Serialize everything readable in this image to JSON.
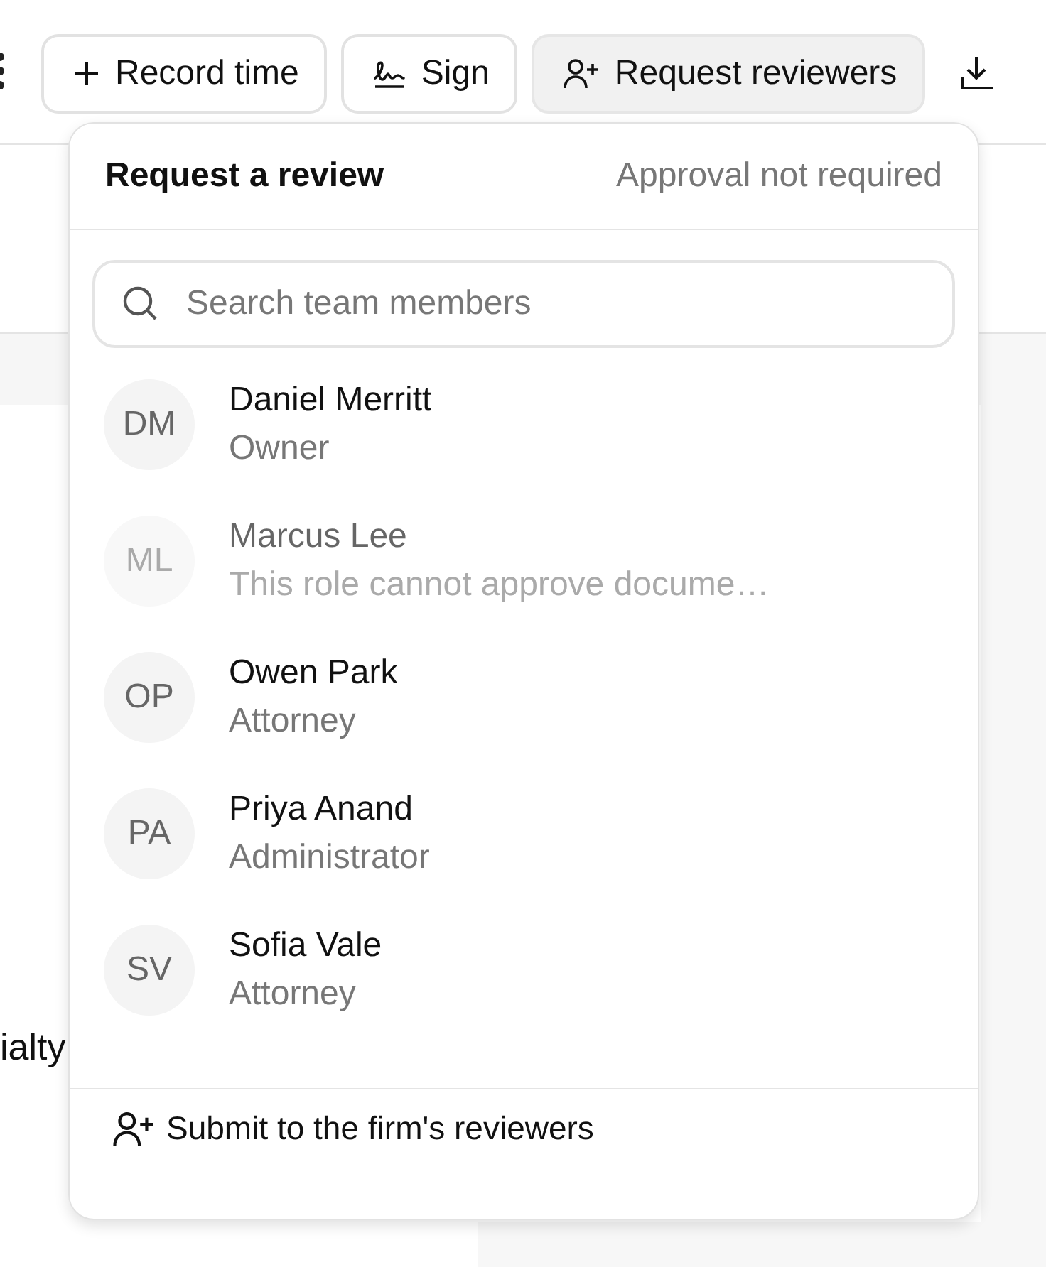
{
  "toolbar": {
    "buttons": [
      {
        "label": "Record time",
        "kind": "plus",
        "selected": false
      },
      {
        "label": "Sign",
        "kind": "signature",
        "selected": false
      },
      {
        "label": "Request reviewers",
        "kind": "user-plus",
        "selected": true
      }
    ]
  },
  "document": {
    "fragments": [
      "ialty"
    ]
  },
  "popover": {
    "title": "Request a review",
    "note": "Approval not required",
    "search": {
      "placeholder": "Search team members"
    },
    "members": [
      {
        "initials": "DM",
        "name": "Daniel Merritt",
        "role": "Owner",
        "disabled": false
      },
      {
        "initials": "ML",
        "name": "Marcus Lee",
        "role": "This role cannot approve docume…",
        "disabled": true
      },
      {
        "initials": "OP",
        "name": "Owen Park",
        "role": "Attorney",
        "disabled": false
      },
      {
        "initials": "PA",
        "name": "Priya Anand",
        "role": "Administrator",
        "disabled": false
      },
      {
        "initials": "SV",
        "name": "Sofia Vale",
        "role": "Attorney",
        "disabled": false
      }
    ],
    "footer_action": "Submit to the firm's reviewers"
  }
}
